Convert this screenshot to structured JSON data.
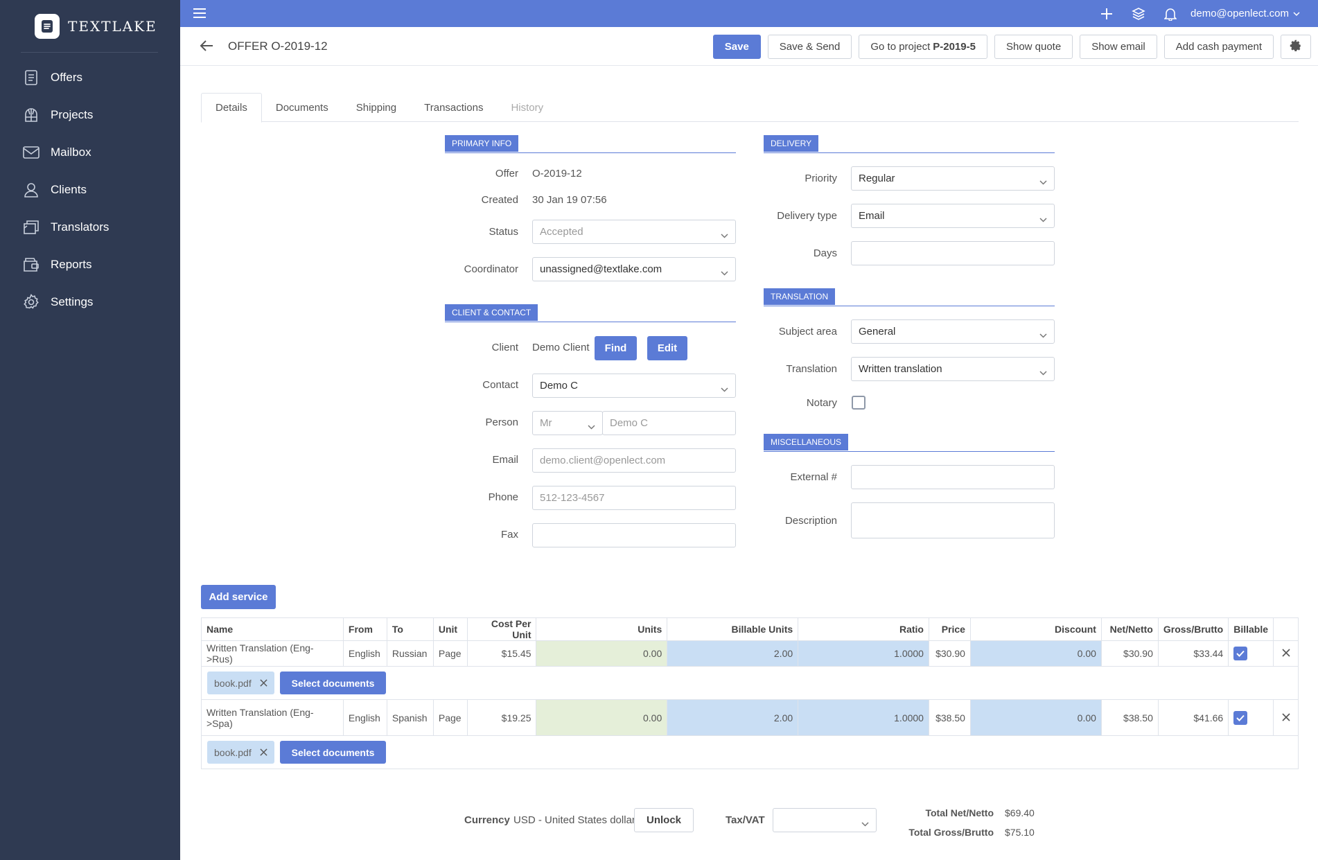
{
  "brand": {
    "name": "TEXTLAKE"
  },
  "sidebar": {
    "items": [
      {
        "label": "Offers",
        "icon": "document-icon"
      },
      {
        "label": "Projects",
        "icon": "globe-icon"
      },
      {
        "label": "Mailbox",
        "icon": "mail-icon"
      },
      {
        "label": "Clients",
        "icon": "person-icon"
      },
      {
        "label": "Translators",
        "icon": "translators-icon"
      },
      {
        "label": "Reports",
        "icon": "reports-icon"
      },
      {
        "label": "Settings",
        "icon": "gear-icon"
      }
    ]
  },
  "topbar": {
    "user": "demo@openlect.com"
  },
  "header": {
    "title": "OFFER O-2019-12",
    "save": "Save",
    "save_send": "Save & Send",
    "goto_project": "Go to project",
    "project_id": "P-2019-5",
    "show_quote": "Show quote",
    "show_email": "Show email",
    "add_cash": "Add cash payment"
  },
  "tabs": [
    "Details",
    "Documents",
    "Shipping",
    "Transactions",
    "History"
  ],
  "primary": {
    "title": "PRIMARY INFO",
    "offer_label": "Offer",
    "offer": "O-2019-12",
    "created_label": "Created",
    "created": "30 Jan 19 07:56",
    "status_label": "Status",
    "status": "Accepted",
    "coordinator_label": "Coordinator",
    "coordinator": "unassigned@textlake.com"
  },
  "client": {
    "title": "CLIENT & CONTACT",
    "client_label": "Client",
    "client": "Demo Client",
    "find": "Find",
    "edit": "Edit",
    "contact_label": "Contact",
    "contact": "Demo C",
    "person_label": "Person",
    "salutation": "Mr",
    "person": "Demo C",
    "email_label": "Email",
    "email": "demo.client@openlect.com",
    "phone_label": "Phone",
    "phone": "512-123-4567",
    "fax_label": "Fax",
    "fax": ""
  },
  "delivery": {
    "title": "DELIVERY",
    "priority_label": "Priority",
    "priority": "Regular",
    "type_label": "Delivery type",
    "type": "Email",
    "days_label": "Days",
    "days": ""
  },
  "translation": {
    "title": "TRANSLATION",
    "subject_label": "Subject area",
    "subject": "General",
    "translation_label": "Translation",
    "translation": "Written translation",
    "notary_label": "Notary"
  },
  "misc": {
    "title": "MISCELLANEOUS",
    "external_label": "External #",
    "external": "",
    "description_label": "Description",
    "description": ""
  },
  "services": {
    "add_label": "Add service",
    "select_docs": "Select documents",
    "columns": [
      "Name",
      "From",
      "To",
      "Unit",
      "Cost Per Unit",
      "Units",
      "Billable Units",
      "Ratio",
      "Price",
      "Discount",
      "Net/Netto",
      "Gross/Brutto",
      "Billable"
    ],
    "rows": [
      {
        "name": "Written Translation (Eng->Rus)",
        "from": "English",
        "to": "Russian",
        "unit": "Page",
        "cost": "$15.45",
        "units": "0.00",
        "billable_units": "2.00",
        "ratio": "1.0000",
        "price": "$30.90",
        "discount": "0.00",
        "net": "$30.90",
        "gross": "$33.44",
        "doc": "book.pdf"
      },
      {
        "name": "Written Translation (Eng->Spa)",
        "from": "English",
        "to": "Spanish",
        "unit": "Page",
        "cost": "$19.25",
        "units": "0.00",
        "billable_units": "2.00",
        "ratio": "1.0000",
        "price": "$38.50",
        "discount": "0.00",
        "net": "$38.50",
        "gross": "$41.66",
        "doc": "book.pdf"
      }
    ]
  },
  "footer": {
    "currency_label": "Currency",
    "currency": "USD - United States dollar",
    "unlock": "Unlock",
    "tax_label": "Tax/VAT",
    "net_label": "Total Net/Netto",
    "net": "$69.40",
    "gross_label": "Total Gross/Brutto",
    "gross": "$75.10"
  },
  "colors": {
    "accent": "#5b7bd6",
    "sidebar": "#2f3a52",
    "units_bg": "#e5efd9",
    "billable_bg": "#c9def4"
  }
}
